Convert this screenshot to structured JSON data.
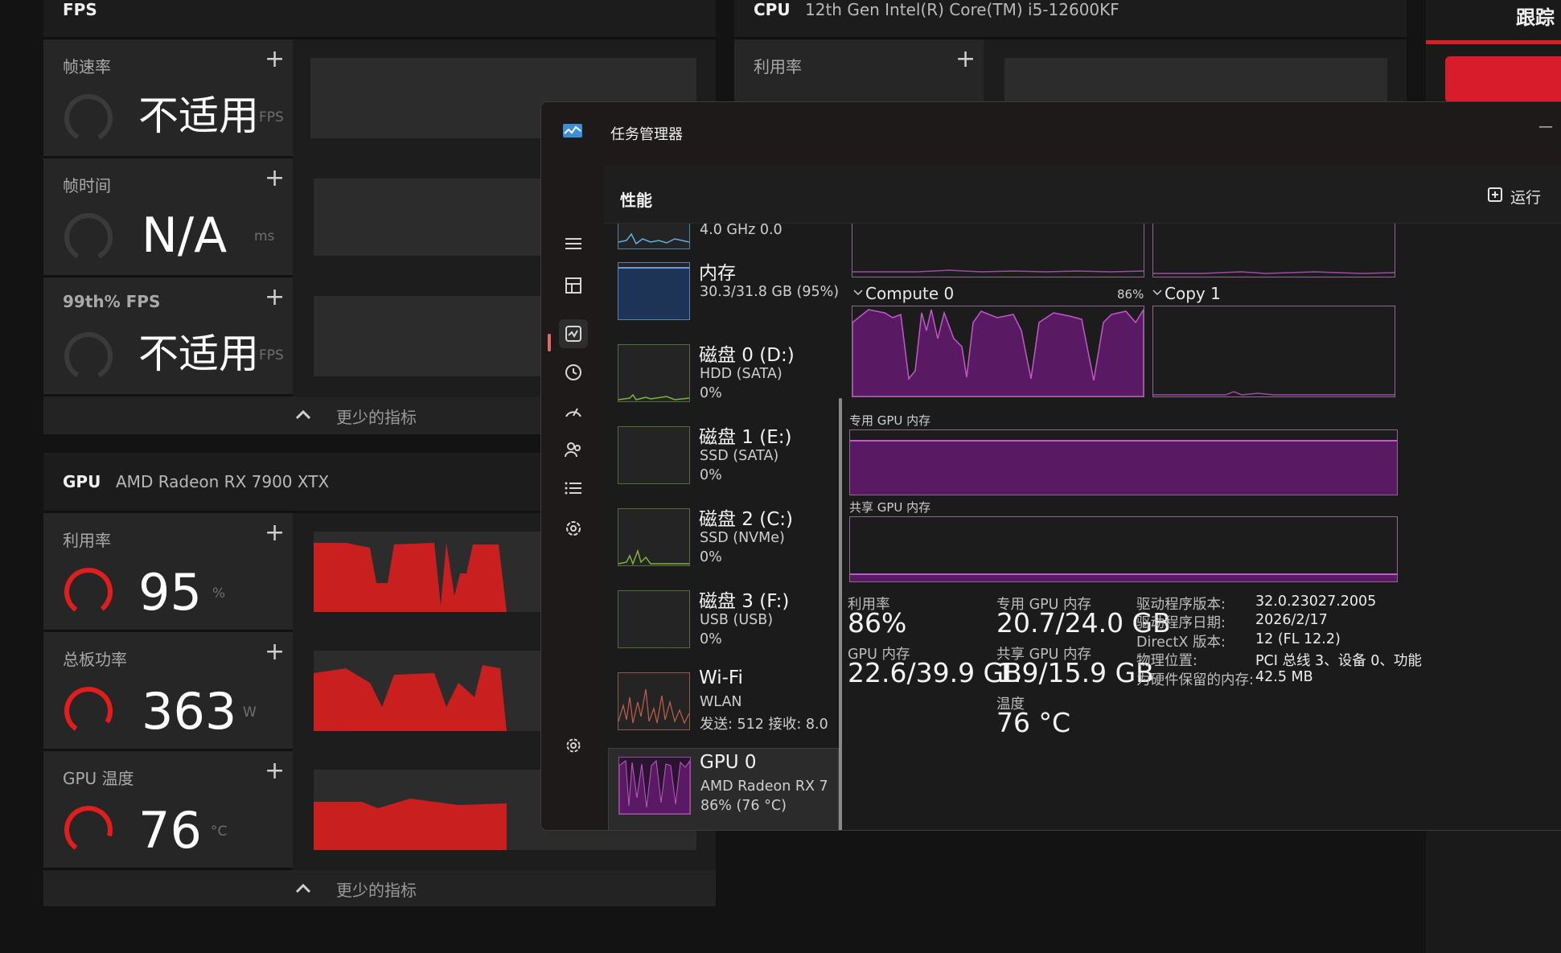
{
  "overlay": {
    "fps_panel": {
      "title": "FPS",
      "metrics": [
        {
          "label": "帧速率",
          "value": "不适用",
          "unit": "FPS"
        },
        {
          "label": "帧时间",
          "value": "N/A",
          "unit": "ms"
        },
        {
          "label": "99th% FPS",
          "value": "不适用",
          "unit": "FPS"
        }
      ],
      "footer": "更少的指标"
    },
    "cpu_panel": {
      "title": "CPU",
      "subtitle": "12th Gen Intel(R) Core(TM) i5-12600KF",
      "metric_label": "利用率"
    },
    "gpu_panel": {
      "title": "GPU",
      "subtitle": "AMD Radeon RX 7900 XTX",
      "metrics": [
        {
          "label": "利用率",
          "value": "95",
          "unit": "%"
        },
        {
          "label": "总板功率",
          "value": "363",
          "unit": "W"
        },
        {
          "label": "GPU 温度",
          "value": "76",
          "unit": "°C"
        }
      ],
      "footer": "更少的指标"
    },
    "right_panel_title": "跟踪",
    "accent_color": "#d42121"
  },
  "taskmgr": {
    "title": "任务管理器",
    "page_title": "性能",
    "run_task_label": "运行",
    "items": [
      {
        "name": "",
        "sub1": "4.0 GHz 0.0",
        "sub2": ""
      },
      {
        "name": "内存",
        "sub1": "30.3/31.8 GB (95%)",
        "sub2": ""
      },
      {
        "name": "磁盘 0 (D:)",
        "sub1": "HDD (SATA)",
        "sub2": "0%"
      },
      {
        "name": "磁盘 1 (E:)",
        "sub1": "SSD (SATA)",
        "sub2": "0%"
      },
      {
        "name": "磁盘 2 (C:)",
        "sub1": "SSD (NVMe)",
        "sub2": "0%"
      },
      {
        "name": "磁盘 3 (F:)",
        "sub1": "USB (USB)",
        "sub2": "0%"
      },
      {
        "name": "Wi-Fi",
        "sub1": "WLAN",
        "sub2": "发送: 512  接收: 8.0"
      },
      {
        "name": "GPU 0",
        "sub1": "AMD Radeon RX 7",
        "sub2": "86% (76 °C)"
      }
    ],
    "graphs": {
      "compute_label": "Compute 0",
      "compute_pct": "86%",
      "copy_label": "Copy 1",
      "dedicated_label": "专用 GPU 内存",
      "shared_label": "共享 GPU 内存"
    },
    "stats": {
      "util_label": "利用率",
      "util_value": "86%",
      "gpumem_label": "GPU 内存",
      "gpumem_value": "22.6/39.9 GB",
      "ded_label": "专用 GPU 内存",
      "ded_value": "20.7/24.0 GB",
      "shared_label": "共享 GPU 内存",
      "shared_value": "1.9/15.9 GB",
      "temp_label": "温度",
      "temp_value": "76 °C"
    },
    "info": [
      {
        "k": "驱动程序版本:",
        "v": "32.0.23027.2005"
      },
      {
        "k": "驱动程序日期:",
        "v": "2026/2/17"
      },
      {
        "k": "DirectX 版本:",
        "v": "12 (FL 12.2)"
      },
      {
        "k": "物理位置:",
        "v": "PCI 总线 3、设备 0、功能"
      },
      {
        "k": "为硬件保留的内存:",
        "v": "42.5 MB"
      }
    ],
    "gpu_color": "#7a1a7a"
  }
}
